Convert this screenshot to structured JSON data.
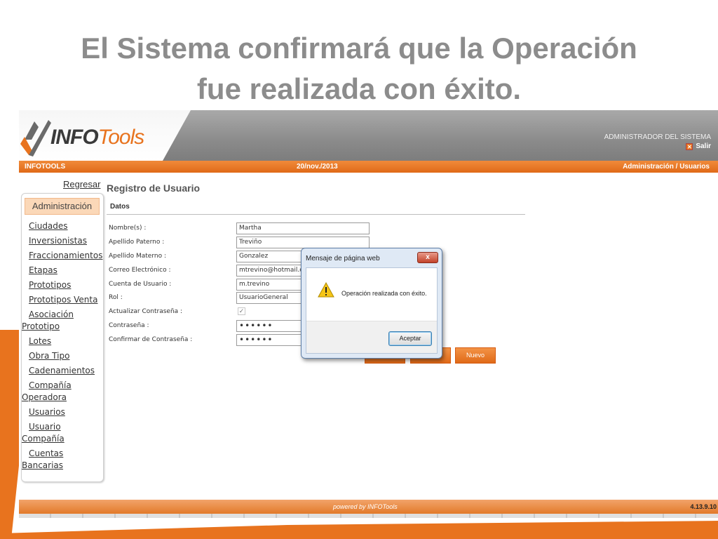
{
  "slide": {
    "title_line1": "El Sistema confirmará que la Operación",
    "title_line2": "fue realizada con éxito."
  },
  "colors": {
    "accent": "#e8731e",
    "header_gray": "#8b8b8b",
    "dialog_border": "#5f7fa8"
  },
  "header": {
    "logo_bold": "INFO",
    "logo_light": "Tools",
    "admin_label": "ADMINISTRADOR DEL SISTEMA",
    "logout_label": "Salir"
  },
  "topbar": {
    "left": "INFOTOOLS",
    "center": "20/nov./2013",
    "right": "Administración / Usuarios"
  },
  "sidebar": {
    "back_link": "Regresar",
    "section": "Administración",
    "items": [
      "Ciudades",
      "Inversionistas",
      "Fraccionamientos",
      "Etapas",
      "Prototipos",
      "Prototipos Venta",
      "Asociación Prototipo",
      "Lotes",
      "Obra Tipo",
      "Cadenamientos",
      "Compañía Operadora",
      "Usuarios",
      "Usuario Compañía",
      "Cuentas Bancarias"
    ]
  },
  "main": {
    "title": "Registro de Usuario",
    "section": "Datos",
    "fields": {
      "nombre_label": "Nombre(s) :",
      "nombre_value": "Martha",
      "paterno_label": "Apellido Paterno :",
      "paterno_value": "Treviño",
      "materno_label": "Apellido Materno :",
      "materno_value": "Gonzalez",
      "correo_label": "Correo Electrónico :",
      "correo_value": "mtrevino@hotmail.com",
      "cuenta_label": "Cuenta de Usuario :",
      "cuenta_value": "m.trevino",
      "rol_label": "Rol :",
      "rol_value": "UsuarioGeneral",
      "actualizar_label": "Actualizar Contraseña :",
      "contrasena_label": "Contraseña :",
      "contrasena_value": "••••••",
      "confirmar_label": "Confirmar de Contraseña :",
      "confirmar_value": "••••••"
    },
    "nuevo_button": "Nuevo"
  },
  "dialog": {
    "title": "Mensaje de página web",
    "close_glyph": "x",
    "message": "Operación realizada con éxito.",
    "ok_button": "Aceptar"
  },
  "footer": {
    "powered": "powered by  INFOTools",
    "version": "4.13.9.10"
  }
}
